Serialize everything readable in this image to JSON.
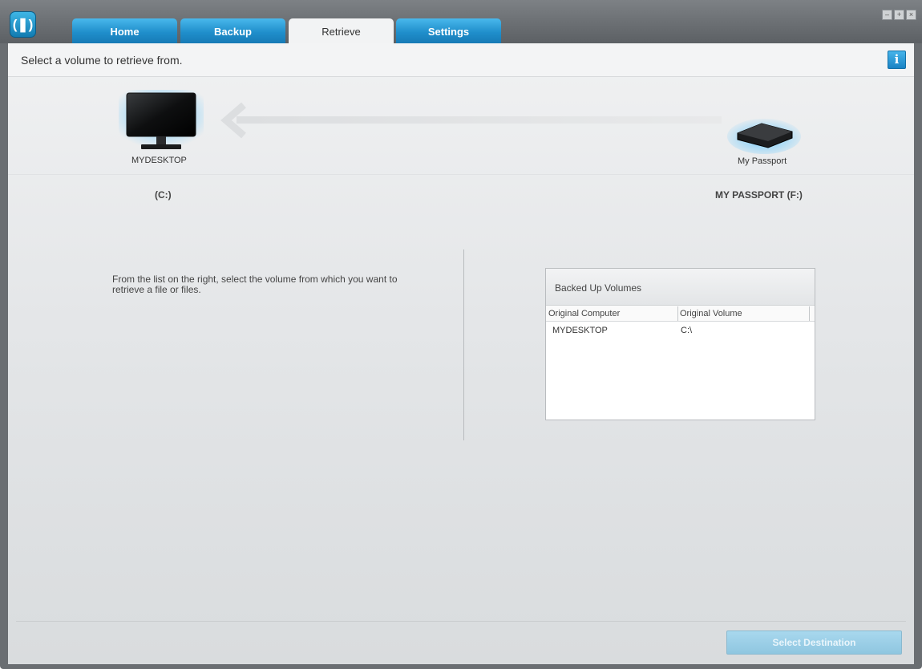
{
  "tabs": [
    {
      "label": "Home"
    },
    {
      "label": "Backup"
    },
    {
      "label": "Retrieve"
    },
    {
      "label": "Settings"
    }
  ],
  "header": {
    "text": "Select a volume to retrieve from.",
    "info_icon": "i"
  },
  "window_controls": {
    "minimize": "–",
    "maximize": "+",
    "close": "×"
  },
  "source_device": {
    "name": "MYDESKTOP",
    "volume": "(C:)",
    "icon": "monitor-icon"
  },
  "target_device": {
    "name": "My Passport",
    "volume": "MY PASSPORT (F:)",
    "icon": "external-drive-icon"
  },
  "instructions": "From the list on the right, select the volume from which you want to retrieve a file or files.",
  "volumes_panel": {
    "title": "Backed Up Volumes",
    "columns": [
      "Original Computer",
      "Original Volume"
    ],
    "rows": [
      {
        "computer": "MYDESKTOP",
        "volume": "C:\\"
      }
    ]
  },
  "footer": {
    "select_destination": "Select Destination"
  },
  "colors": {
    "accent": "#1f8ecb",
    "button_disabled": "#9fcfe6"
  }
}
